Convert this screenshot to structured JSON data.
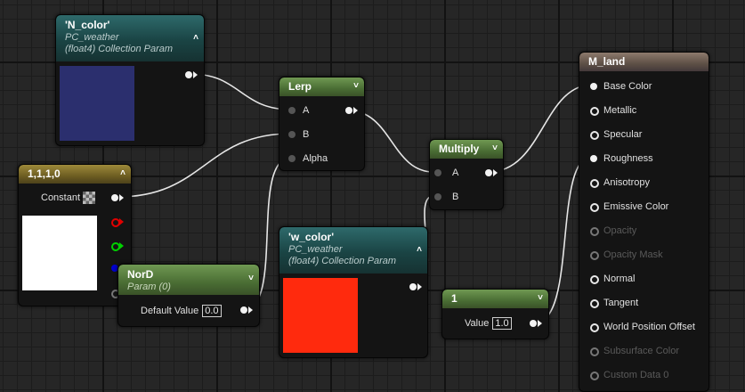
{
  "nodes": {
    "n_color": {
      "title": "'N_color'",
      "subtitle1": "PC_weather",
      "subtitle2": "(float4) Collection Param",
      "swatch": "#2b2f6e"
    },
    "lerp": {
      "title": "Lerp",
      "pins": [
        "A",
        "B",
        "Alpha"
      ]
    },
    "multiply": {
      "title": "Multiply",
      "pins": [
        "A",
        "B"
      ]
    },
    "constant4": {
      "title": "1,1,1,0",
      "label": "Constant",
      "swatch": "#ffffff"
    },
    "nord": {
      "title": "NorD",
      "subtitle": "Param (0)",
      "label": "Default Value",
      "value": "0.0"
    },
    "w_color": {
      "title": "'w_color'",
      "subtitle1": "PC_weather",
      "subtitle2": "(float4) Collection Param",
      "swatch": "#ff2a0d"
    },
    "scalar": {
      "title": "1",
      "label": "Value",
      "value": "1.0"
    },
    "m_land": {
      "title": "M_land",
      "pins": [
        {
          "label": "Base Color",
          "enabled": true,
          "connected": true
        },
        {
          "label": "Metallic",
          "enabled": true,
          "connected": false
        },
        {
          "label": "Specular",
          "enabled": true,
          "connected": false
        },
        {
          "label": "Roughness",
          "enabled": true,
          "connected": true
        },
        {
          "label": "Anisotropy",
          "enabled": true,
          "connected": false
        },
        {
          "label": "Emissive Color",
          "enabled": true,
          "connected": false
        },
        {
          "label": "Opacity",
          "enabled": false,
          "connected": false
        },
        {
          "label": "Opacity Mask",
          "enabled": false,
          "connected": false
        },
        {
          "label": "Normal",
          "enabled": true,
          "connected": false
        },
        {
          "label": "Tangent",
          "enabled": true,
          "connected": false
        },
        {
          "label": "World Position Offset",
          "enabled": true,
          "connected": false
        },
        {
          "label": "Subsurface Color",
          "enabled": false,
          "connected": false
        },
        {
          "label": "Custom Data 0",
          "enabled": false,
          "connected": false
        }
      ]
    }
  },
  "colors": {
    "wire": "#e6e6e6",
    "background": "#262626"
  }
}
